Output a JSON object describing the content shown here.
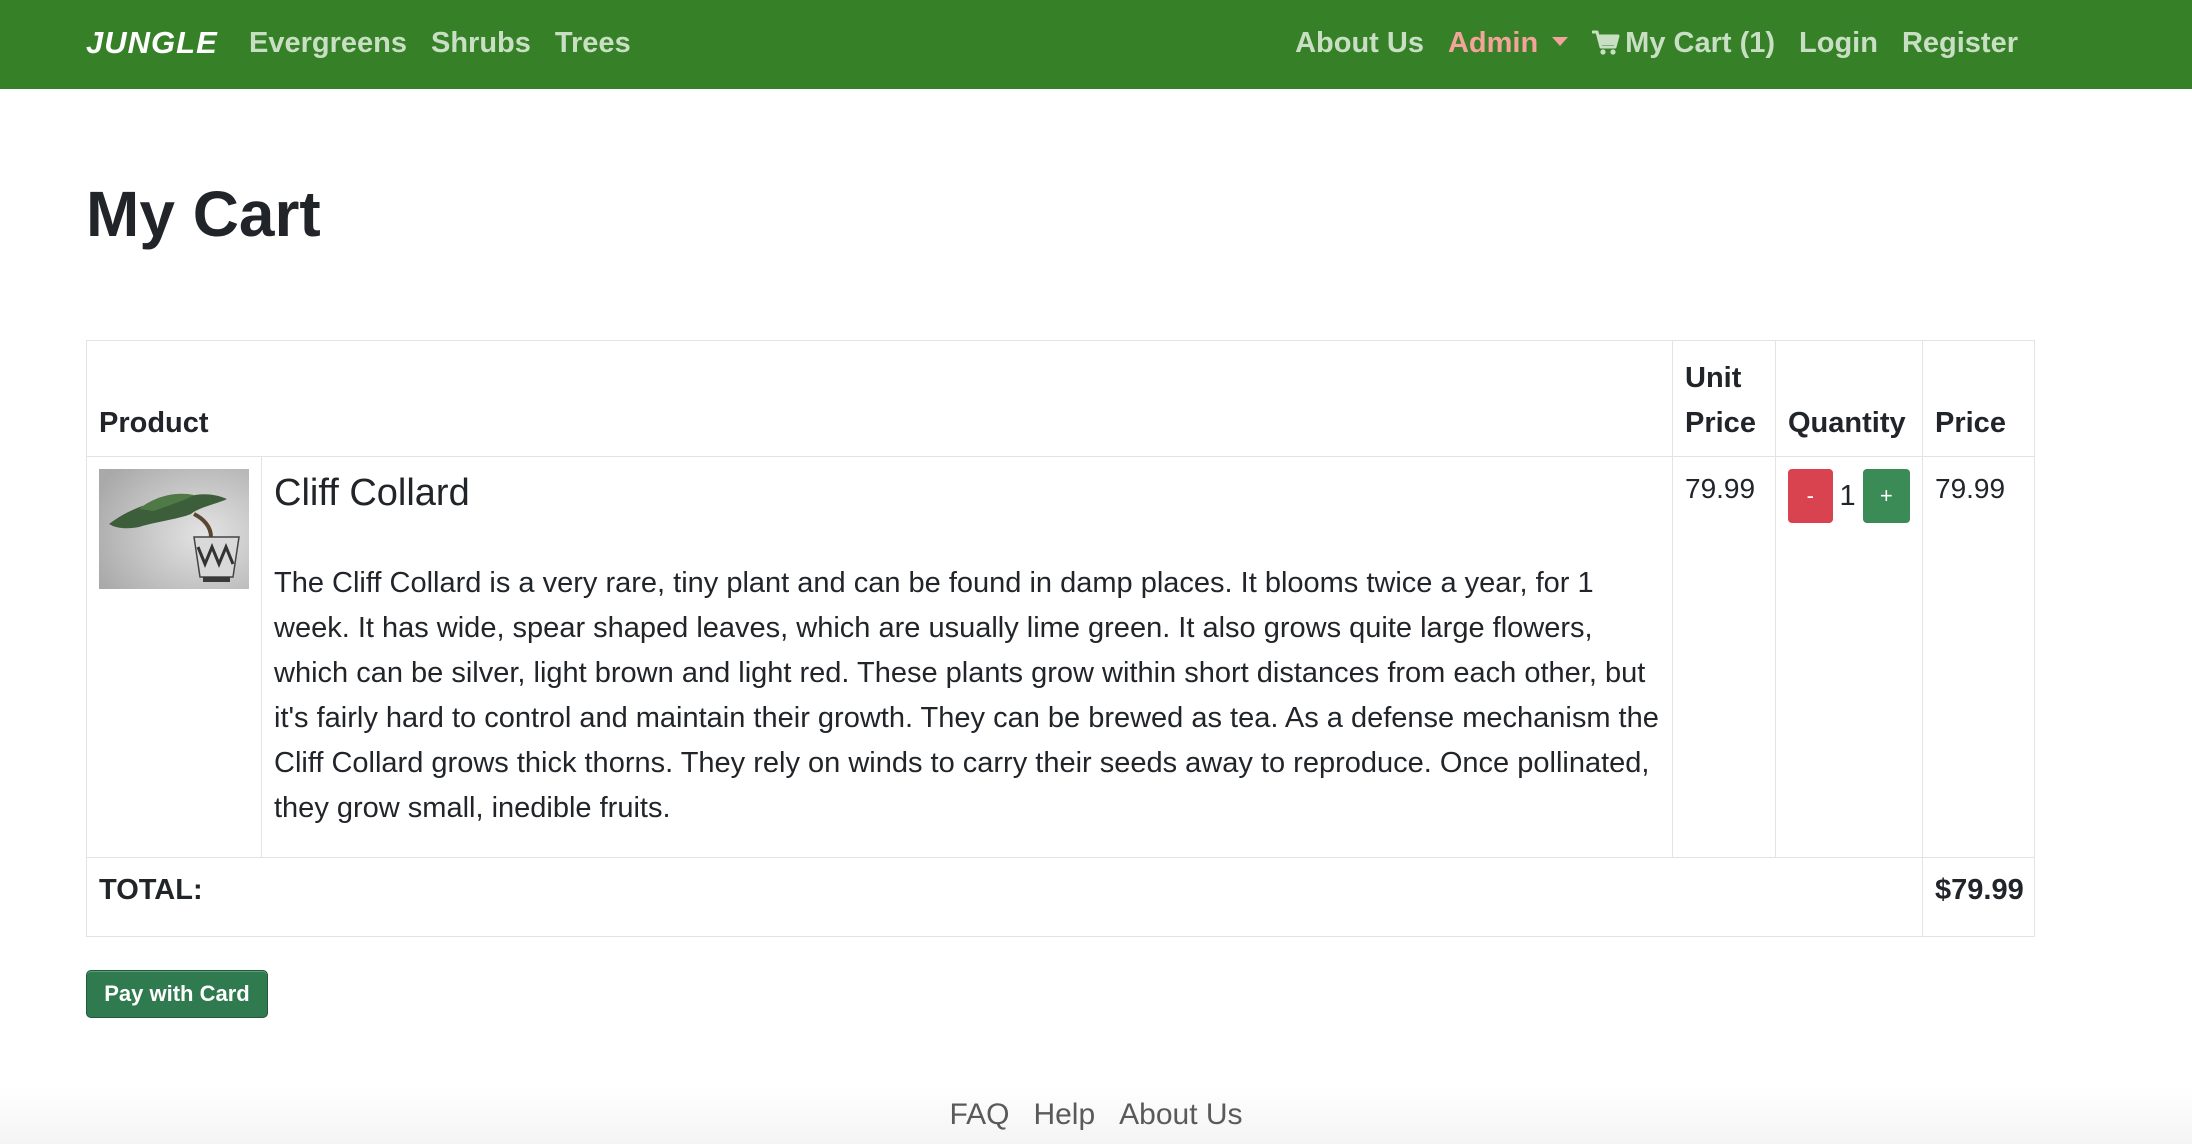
{
  "navbar": {
    "brand": "JUNGLE",
    "left_links": [
      "Evergreens",
      "Shrubs",
      "Trees"
    ],
    "about": "About Us",
    "admin": "Admin",
    "cart": "My Cart (1)",
    "login": "Login",
    "register": "Register",
    "colors": {
      "background": "#368027",
      "link": "#c9dfc4",
      "admin": "#f2a39a"
    }
  },
  "page": {
    "title": "My Cart"
  },
  "table": {
    "headers": {
      "product": "Product",
      "unit_price": "Unit Price",
      "quantity": "Quantity",
      "price": "Price"
    },
    "items": [
      {
        "name": "Cliff Collard",
        "description": "The Cliff Collard is a very rare, tiny plant and can be found in damp places. It blooms twice a year, for 1 week. It has wide, spear shaped leaves, which are usually lime green. It also grows quite large flowers, which can be silver, light brown and light red. These plants grow within short distances from each other, but it's fairly hard to control and maintain their growth. They can be brewed as tea. As a defense mechanism the Cliff Collard grows thick thorns. They rely on winds to carry their seeds away to reproduce. Once pollinated, they grow small, inedible fruits.",
        "unit_price": "79.99",
        "quantity": "1",
        "decrement_label": "-",
        "increment_label": "+",
        "price": "79.99",
        "image_icon": "bonsai-plant-image"
      }
    ],
    "total_label": "TOTAL:",
    "total_value": "$79.99"
  },
  "actions": {
    "pay_label": "Pay with Card",
    "pay_color": "#2f7a4f",
    "minus_color": "#d9434f",
    "plus_color": "#3a8b55"
  },
  "footer": {
    "links": [
      "FAQ",
      "Help",
      "About Us"
    ]
  }
}
